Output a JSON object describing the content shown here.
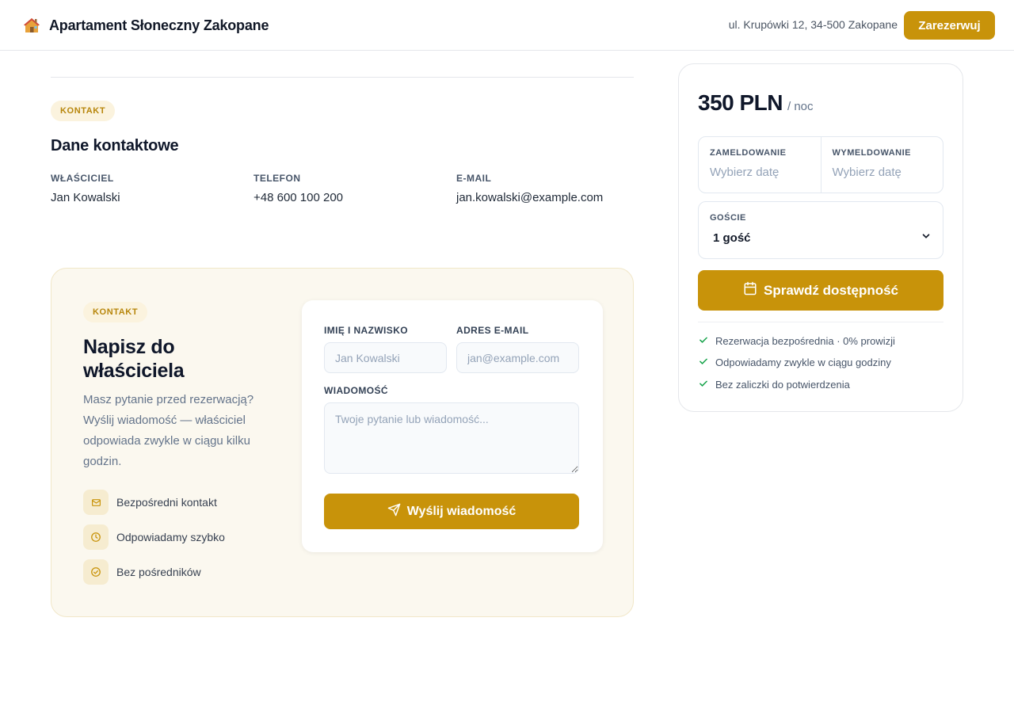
{
  "header": {
    "brand_icon": "house-icon",
    "title": "Apartament Słoneczny Zakopane",
    "address": "ul. Krupówki 12, 34-500 Zakopane",
    "reserve_label": "Zarezerwuj"
  },
  "contact": {
    "tag": "KONTAKT",
    "title": "Dane kontaktowe",
    "owner": {
      "label": "WŁAŚCICIEL",
      "value": "Jan Kowalski"
    },
    "phone": {
      "label": "TELEFON",
      "value": "+48 600 100 200"
    },
    "email": {
      "label": "E-MAIL",
      "value": "jan.kowalski@example.com"
    }
  },
  "message": {
    "tag": "KONTAKT",
    "title": "Napisz do właściciela",
    "description": "Masz pytanie przed rezerwacją? Wyślij wiadomość — właściciel odpowiada zwykle w ciągu kilku godzin.",
    "features": [
      {
        "icon": "mail-icon",
        "label": "Bezpośredni kontakt"
      },
      {
        "icon": "clock-icon",
        "label": "Odpowiadamy szybko"
      },
      {
        "icon": "check-circle-icon",
        "label": "Bez pośredników"
      }
    ],
    "form": {
      "name_label": "IMIĘ I NAZWISKO",
      "name_placeholder": "Jan Kowalski",
      "email_label": "ADRES E-MAIL",
      "email_placeholder": "jan@example.com",
      "message_label": "WIADOMOŚĆ",
      "message_placeholder": "Twoje pytanie lub wiadomość...",
      "send_label": "Wyślij wiadomość"
    }
  },
  "booking": {
    "price": "350 PLN",
    "per_night": "/ noc",
    "checkin_label": "ZAMELDOWANIE",
    "checkin_value": "Wybierz datę",
    "checkout_label": "WYMELDOWANIE",
    "checkout_value": "Wybierz datę",
    "guests_label": "GOŚCIE",
    "guests_value": "1 gość",
    "check_label": "Sprawdź dostępność",
    "benefits": [
      "Rezerwacja bezpośrednia · 0% prowizji",
      "Odpowiadamy zwykle w ciągu godziny",
      "Bez zaliczki do potwierdzenia"
    ]
  },
  "colors": {
    "accent": "#c8930a",
    "accent_soft": "#fbf3de",
    "check_green": "#16a34a"
  }
}
